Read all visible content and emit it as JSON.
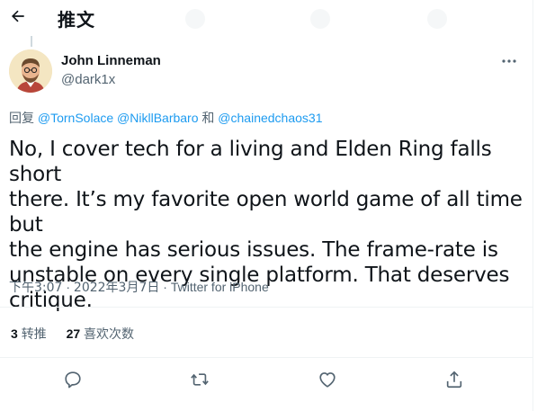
{
  "header": {
    "title": "推文"
  },
  "author": {
    "display_name": "John Linneman",
    "handle": "@dark1x"
  },
  "reply": {
    "prefix": "回复",
    "mention1": "@TornSolace",
    "mention2": "@NikllBarbaro",
    "conjunction": "和",
    "mention3": "@chainedchaos31"
  },
  "tweet": {
    "text": "No, I cover tech for a living and Elden Ring falls short\nthere. It’s my favorite open world game of all time but\nthe engine has serious issues. The frame-rate is\nunstable on every single platform. That deserves\ncritique."
  },
  "meta": {
    "time": "下午3:07",
    "separator": "·",
    "date": "2022年3月7日",
    "source": "Twitter for iPhone"
  },
  "stats": {
    "retweets_count": "3",
    "retweets_label": "转推",
    "likes_count": "27",
    "likes_label": "喜欢次数"
  },
  "icons": {
    "back": "arrow-left-icon",
    "more": "more-horizontal-icon",
    "reply": "speech-bubble-icon",
    "retweet": "retweet-icon",
    "like": "heart-icon",
    "share": "share-upload-icon"
  },
  "colors": {
    "link": "#1d9bf0",
    "secondary_text": "#536471",
    "primary_text": "#0f1419"
  }
}
